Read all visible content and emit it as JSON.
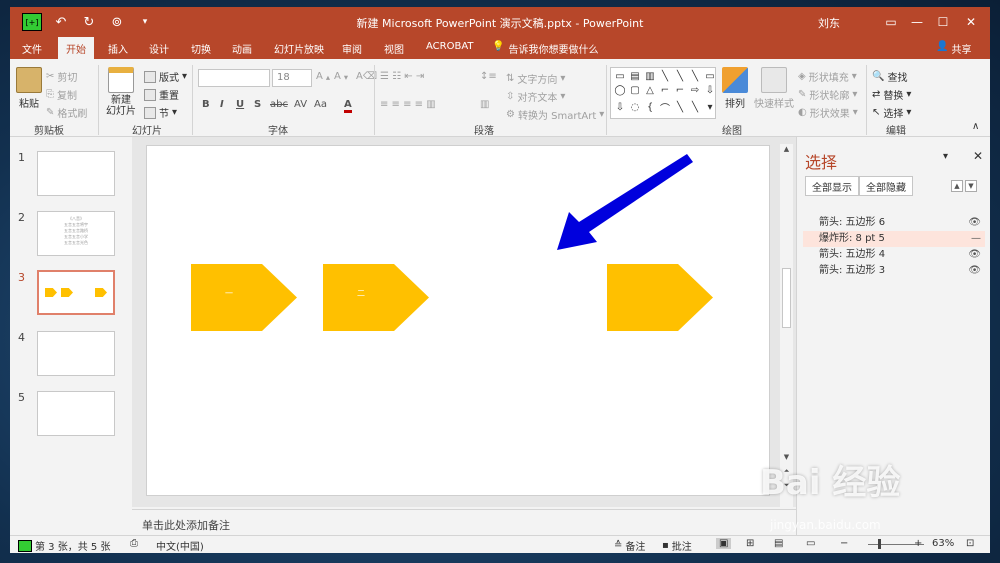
{
  "titlebar": {
    "title": "新建 Microsoft PowerPoint 演示文稿.pptx  -  PowerPoint",
    "user": "刘东",
    "qat_save": "[+]"
  },
  "tabs": [
    "文件",
    "开始",
    "插入",
    "设计",
    "切换",
    "动画",
    "幻灯片放映",
    "审阅",
    "视图",
    "ACROBAT"
  ],
  "active_tab": "开始",
  "tellme": "告诉我你想要做什么",
  "share": "共享",
  "ribbon": {
    "clipboard": {
      "label": "剪贴板",
      "paste": "粘贴",
      "cut": "剪切",
      "copy": "复制",
      "format_painter": "格式刷"
    },
    "slides": {
      "label": "幻灯片",
      "new_slide": "新建\n幻灯片",
      "layout": "版式",
      "reset": "重置",
      "section": "节"
    },
    "font": {
      "label": "字体",
      "font_name": "",
      "font_size": "18",
      "bold": "B",
      "italic": "I",
      "underline": "U",
      "shadow": "S",
      "strike": "abc",
      "spacing": "AV",
      "case": "Aa",
      "color": "A"
    },
    "paragraph": {
      "label": "段落",
      "text_direction": "文字方向",
      "align_text": "对齐文本",
      "smartart": "转换为 SmartArt"
    },
    "drawing": {
      "label": "绘图",
      "arrange": "排列",
      "quick_styles": "快速样式",
      "shape_fill": "形状填充",
      "shape_outline": "形状轮廓",
      "shape_effect": "形状效果"
    },
    "editing": {
      "label": "编辑",
      "find": "查找",
      "replace": "替换",
      "select": "选择"
    }
  },
  "thumbnails": [
    {
      "num": "1",
      "active": false
    },
    {
      "num": "2",
      "active": false,
      "text": "《八音》\n五言五言将宇\n五言五言路桥\n五言五言小学\n五言五言光色"
    },
    {
      "num": "3",
      "active": true
    },
    {
      "num": "4",
      "active": false
    },
    {
      "num": "5",
      "active": false
    }
  ],
  "slide_shapes": {
    "arrow1_label": "一",
    "arrow2_label": "二"
  },
  "notes_placeholder": "单击此处添加备注",
  "selection_pane": {
    "title": "选择",
    "show_all": "全部显示",
    "hide_all": "全部隐藏",
    "items": [
      {
        "name": "箭头: 五边形 6",
        "visible": true
      },
      {
        "name": "爆炸形: 8 pt  5",
        "visible": false
      },
      {
        "name": "箭头: 五边形 4",
        "visible": true
      },
      {
        "name": "箭头: 五边形 3",
        "visible": true
      }
    ]
  },
  "status": {
    "slide_info": "第 3 张，共 5 张",
    "language": "中文(中国)",
    "notes": "备注",
    "comments": "批注",
    "zoom": "63%"
  },
  "watermark": {
    "brand": "Bai  经验",
    "url": "jingyan.baidu.com"
  },
  "colors": {
    "accent": "#b7472a",
    "shape_fill": "#ffc000",
    "blue_arrow": "#0000dd"
  }
}
